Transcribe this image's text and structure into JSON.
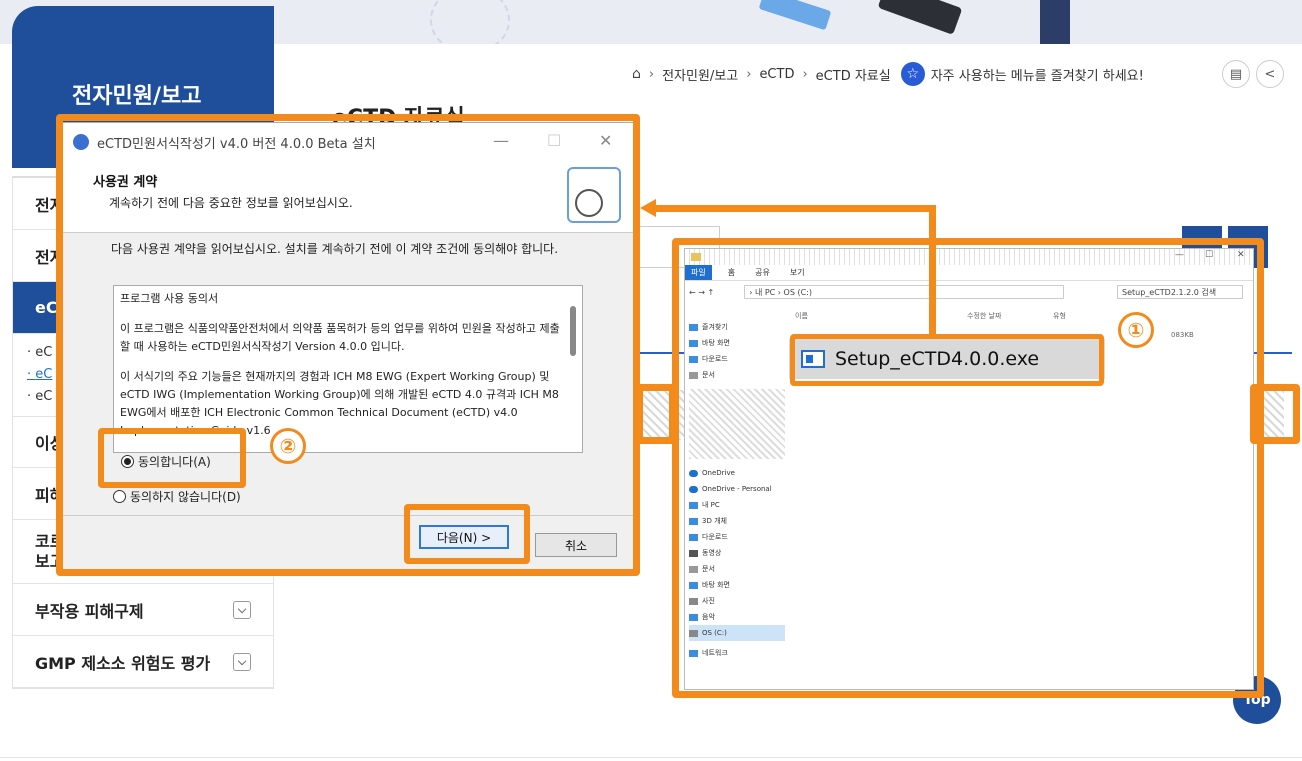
{
  "site": {
    "side_title": "전자민원/보고",
    "breadcrumb": [
      "전자민원/보고",
      "eCTD",
      "eCTD 자료실"
    ],
    "favorite_text": "자주 사용하는 메뉴를 즐겨찾기 하세요!",
    "page_title": "eCTD 자료실",
    "menu": [
      {
        "label": "전자",
        "active": false
      },
      {
        "label": "전자",
        "active": false
      },
      {
        "label": "eC",
        "active": true
      }
    ],
    "submenu": [
      "eC",
      "eC",
      "eC"
    ],
    "menu_lower": [
      {
        "label": "이상",
        "has_toggle": false
      },
      {
        "label": "피해",
        "has_toggle": false
      },
      {
        "label": "코로\n보고",
        "has_toggle": true
      },
      {
        "label": "부작용 피해구제",
        "has_toggle": true
      },
      {
        "label": "GMP 제소소 위험도 평가",
        "has_toggle": true
      }
    ],
    "top_button": "Top"
  },
  "installer": {
    "window_title": "eCTD민원서식작성기 v4.0 버전 4.0.0 Beta 설치",
    "header_title": "사용권 계약",
    "header_subtitle": "계속하기 전에 다음 중요한 정보를 읽어보십시오.",
    "intro": "다음 사용권 계약을 읽어보십시오. 설치를 계속하기 전에 이 계약 조건에 동의해야 합니다.",
    "license_paragraphs": [
      "프로그램 사용 동의서",
      "이 프로그램은 식품의약품안전처에서 의약품 품목허가 등의 업무를 위하여 민원을 작성하고 제출할 때 사용하는 eCTD민원서식작성기 Version 4.0.0 입니다.",
      "이 서식기의 주요 기능들은 현재까지의 경험과 ICH M8 EWG (Expert Working Group) 및 eCTD IWG (Implementation Working Group)에 의해 개발된 eCTD 4.0 규격과 ICH M8 EWG에서 배포한 ICH Electronic Common Technical Document (eCTD) v4.0 Implementation Guide v1.6"
    ],
    "agree_label": "동의합니다(A)",
    "disagree_label": "동의하지 않습니다(D)",
    "next_button": "다음(N) >",
    "cancel_button": "취소",
    "minimize": "—",
    "maximize": "☐",
    "close": "✕"
  },
  "explorer": {
    "ribbon_tabs": [
      "파일",
      "홈",
      "공유",
      "보기"
    ],
    "address": "› 내 PC › OS (C:)",
    "search_placeholder": "Setup_eCTD2.1.2.0 검색",
    "columns": [
      "이름",
      "수정한 날짜",
      "유형"
    ],
    "nav_items": [
      "즐겨찾기",
      "바탕 화면",
      "다운로드",
      "문서",
      "OneDrive",
      "OneDrive - Personal",
      "내 PC",
      "3D 개체",
      "다운로드",
      "동영상",
      "문서",
      "바탕 화면",
      "사진",
      "음악",
      "OS (C:)",
      "네트워크"
    ],
    "file_name": "Setup_eCTD4.0.0.exe",
    "file_size": "083KB"
  },
  "badges": {
    "step1": "①",
    "step2": "②"
  },
  "colors": {
    "highlight": "#f28a1c",
    "brand": "#1f4f9b",
    "accent": "#2a5bd7"
  }
}
